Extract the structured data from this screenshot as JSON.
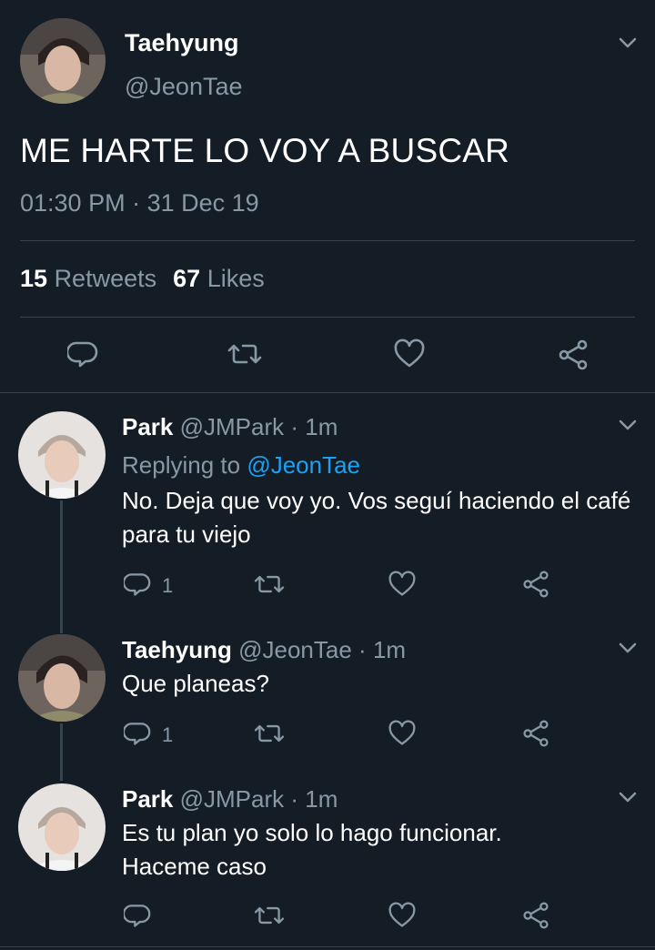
{
  "colors": {
    "background": "#141d26",
    "muted": "#8899a6",
    "link": "#1da1f2",
    "divider": "#38444d"
  },
  "main_tweet": {
    "name": "Taehyung",
    "handle": "@JeonTae",
    "text": "ME HARTE LO VOY A BUSCAR",
    "time": "01:30 PM",
    "separator": "·",
    "date": "31 Dec 19",
    "retweets_count": "15",
    "retweets_label": "Retweets",
    "likes_count": "67",
    "likes_label": "Likes",
    "icons": [
      "reply-icon",
      "retweet-icon",
      "like-icon",
      "share-icon",
      "chevron-down-icon"
    ]
  },
  "replies": [
    {
      "name": "Park",
      "handle": "@JMPark",
      "sep": "·",
      "time": "1m",
      "replying_prefix": "Replying to",
      "replying_handle": "@JeonTae",
      "text": "No. Deja que voy yo. Vos seguí haciendo el café para tu viejo",
      "reply_count": "1"
    },
    {
      "name": "Taehyung",
      "handle": "@JeonTae",
      "sep": "·",
      "time": "1m",
      "text": "Que planeas?",
      "reply_count": "1"
    },
    {
      "name": "Park",
      "handle": "@JMPark",
      "sep": "·",
      "time": "1m",
      "text": "Es tu plan yo solo lo hago funcionar. Haceme caso",
      "reply_count": ""
    }
  ]
}
